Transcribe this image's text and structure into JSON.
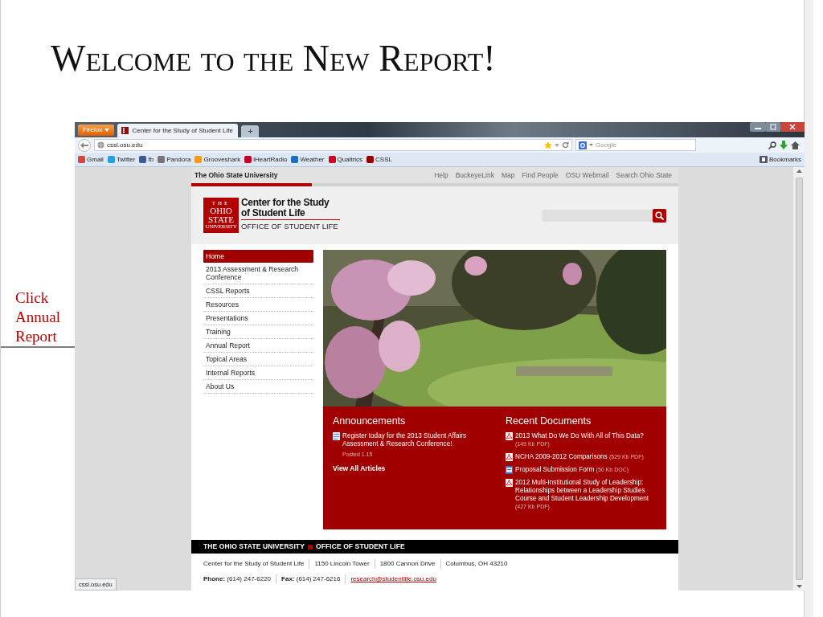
{
  "slide": {
    "title": "Welcome to the New Report!",
    "callout": "Click Annual Report"
  },
  "browser": {
    "menu_button": "Firefox",
    "tabs": [
      {
        "label": "Center for the Study of Student Life",
        "selected": true
      }
    ],
    "new_tab": "+",
    "address": "cssl.osu.edu",
    "search_placeholder": "Google",
    "bookmarks": [
      {
        "label": "Gmail",
        "color": "#d44638"
      },
      {
        "label": "Twitter",
        "color": "#2a9fe0"
      },
      {
        "label": "fb",
        "color": "#3b5998"
      },
      {
        "label": "Pandora",
        "color": "#777777"
      },
      {
        "label": "Grooveshark",
        "color": "#f39c1e"
      },
      {
        "label": "iHeartRadio",
        "color": "#c6002b"
      },
      {
        "label": "Weather",
        "color": "#1e6fc0"
      },
      {
        "label": "Qualtrics",
        "color": "#d5001c"
      },
      {
        "label": "CSSL",
        "color": "#990000"
      }
    ],
    "bookmarks_menu": "Bookmarks",
    "status_url": "cssl.osu.edu"
  },
  "site": {
    "top_bar": {
      "university": "The Ohio State University",
      "links": [
        "Help",
        "BuckeyeLink",
        "Map",
        "Find People",
        "OSU Webmail",
        "Search Ohio State"
      ]
    },
    "logo": {
      "mark": [
        "THE",
        "OHIO",
        "STATE",
        "UNIVERSITY"
      ],
      "title": "Center for the Study of Student Life",
      "subtitle": "OFFICE OF STUDENT LIFE"
    },
    "nav": [
      {
        "label": "Home",
        "selected": true
      },
      {
        "label": "2013 Assessment & Research Conference",
        "selected": false
      },
      {
        "label": "CSSL Reports",
        "selected": false
      },
      {
        "label": "Resources",
        "selected": false
      },
      {
        "label": "Presentations",
        "selected": false
      },
      {
        "label": "Training",
        "selected": false
      },
      {
        "label": "Annual Report",
        "selected": false
      },
      {
        "label": "Topical Areas",
        "selected": false
      },
      {
        "label": "Internal Reports",
        "selected": false
      },
      {
        "label": "About Us",
        "selected": false
      }
    ],
    "announcements": {
      "heading": "Announcements",
      "items": [
        {
          "text": "Register today for the 2013 Student Affairs Assessment & Research Conference!",
          "posted": "Posted 1.15"
        }
      ],
      "link": "View All Articles"
    },
    "documents": {
      "heading": "Recent Documents",
      "items": [
        {
          "kind": "pdf",
          "title": "2013 What Do We Do With All of This Data?",
          "meta": "(149 Kb PDF)"
        },
        {
          "kind": "pdf",
          "title": "NCHA 2009-2012 Comparisons",
          "meta": "(529 Kb PDF)"
        },
        {
          "kind": "doc",
          "title": "Proposal Submission Form",
          "meta": "(50 Kb DOC)"
        },
        {
          "kind": "pdf",
          "title": "2012 Multi-Institutional Study of Leadership: Relationships between a Leadership Studies Course and Student Leadership Development",
          "meta": "(427 Kb PDF)"
        }
      ]
    },
    "footer": {
      "banner": [
        "THE OHIO STATE UNIVERSITY",
        "OFFICE OF STUDENT LIFE"
      ],
      "address": [
        "Center for the Study of Student Life",
        "1150 Lincoln Tower",
        "1800 Cannon Drive",
        "Columbus, OH 43210"
      ],
      "contact": [
        "**Phone:** (614) 247-6220",
        "**Fax:** (614) 247-6216"
      ],
      "email": "research@studentlife.osu.edu"
    }
  }
}
